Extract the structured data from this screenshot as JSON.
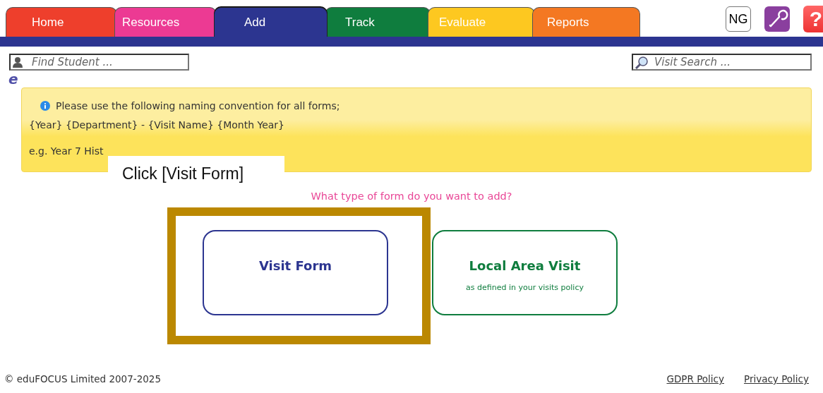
{
  "tabs": [
    {
      "label": "Home",
      "color": "#ee3f2c",
      "selected": false
    },
    {
      "label": "Resources",
      "color": "#ec3a93",
      "selected": false
    },
    {
      "label": "Add",
      "color": "#2c3590",
      "selected": true
    },
    {
      "label": "Track",
      "color": "#0f7d3e",
      "selected": false
    },
    {
      "label": "Evaluate",
      "color": "#fdc820",
      "selected": false
    },
    {
      "label": "Reports",
      "color": "#f47822",
      "selected": false
    }
  ],
  "user_initials": "NG",
  "help_label": "?",
  "student_search": {
    "placeholder": "Find Student ..."
  },
  "visit_search": {
    "placeholder": "Visit Search ..."
  },
  "logo_letter": "e",
  "notice": {
    "lines": [
      "Please use the following naming convention for all forms;",
      "{Year} {Department} - {Visit Name} {Month Year}",
      "e.g.  Year 7 Hist"
    ]
  },
  "callout": "Click [Visit Form]",
  "question": "What type of form do you want to add?",
  "options": [
    {
      "title": "Visit Form",
      "color": "#2c3590",
      "highlighted": true
    },
    {
      "title": "Local Area Visit",
      "subtitle": "as defined in your visits policy",
      "color": "#0f7d3e",
      "highlighted": false
    }
  ],
  "footer": {
    "copyright": "© eduFOCUS Limited 2007-2025",
    "links": [
      "GDPR Policy",
      "Privacy Policy"
    ]
  }
}
